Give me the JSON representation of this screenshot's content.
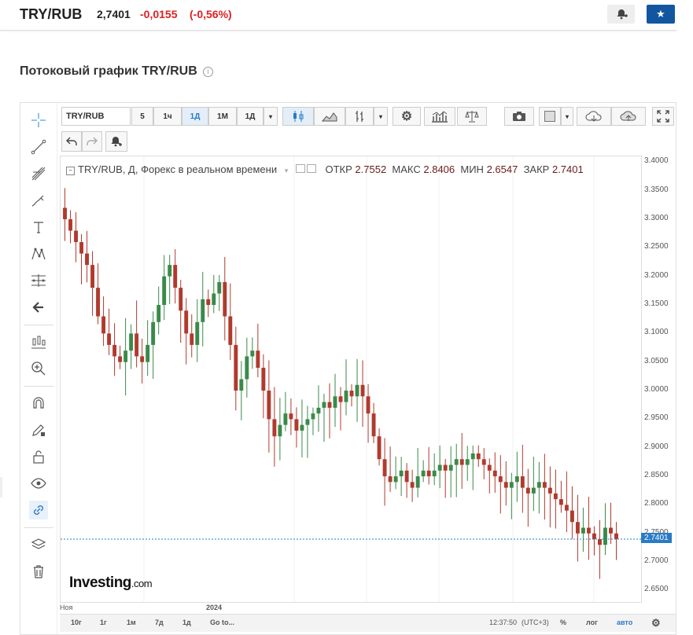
{
  "header": {
    "pair": "TRY/RUB",
    "price": "2,7401",
    "change": "-0,0155",
    "change_pct": "(-0,56%)"
  },
  "section_title": "Потоковый график TRY/RUB",
  "toolbar": {
    "symbol": "TRY/RUB",
    "intervals": [
      "5",
      "1ч",
      "1Д",
      "1М",
      "1Д"
    ],
    "active_interval": "1Д"
  },
  "legend": {
    "name": "TRY/RUB, Д, Форекс в реальном времени",
    "open_label": "ОТКР",
    "open": "2.7552",
    "high_label": "МАКС",
    "high": "2.8406",
    "low_label": "МИН",
    "low": "2.6547",
    "close_label": "ЗАКР",
    "close": "2.7401"
  },
  "yaxis_ticks": [
    "3.4000",
    "3.3500",
    "3.3000",
    "3.2500",
    "3.2000",
    "3.1500",
    "3.1000",
    "3.0500",
    "3.0000",
    "2.9500",
    "2.9000",
    "2.8500",
    "2.8000",
    "2.7500",
    "2.7000",
    "2.6500"
  ],
  "current_price_label": "2.7401",
  "xaxis_labels": [
    "Ноя",
    "2024"
  ],
  "bottom": {
    "ranges": [
      "10г",
      "1г",
      "1м",
      "7д",
      "1д",
      "Go to..."
    ],
    "time": "12:37:50",
    "tz": "(UTC+3)",
    "pct": "%",
    "log": "лог",
    "auto": "авто"
  },
  "logo": {
    "main": "Investing",
    "suffix": ".com"
  },
  "colors": {
    "up": "#3a8a4a",
    "down": "#b03a2e",
    "accent": "#2a7bc6",
    "star": "#1256a0"
  },
  "chart_data": {
    "type": "candlestick",
    "ylim": [
      2.63,
      3.41
    ],
    "close_series": [
      3.3,
      3.28,
      3.26,
      3.24,
      3.22,
      3.18,
      3.13,
      3.1,
      3.08,
      3.06,
      3.05,
      3.07,
      3.1,
      3.06,
      3.05,
      3.08,
      3.12,
      3.15,
      3.2,
      3.22,
      3.18,
      3.14,
      3.1,
      3.08,
      3.12,
      3.16,
      3.15,
      3.17,
      3.19,
      3.13,
      3.08,
      3.0,
      3.02,
      3.06,
      3.07,
      3.04,
      3.0,
      2.95,
      2.92,
      2.94,
      2.96,
      2.95,
      2.93,
      2.94,
      2.95,
      2.96,
      2.97,
      2.98,
      2.97,
      2.99,
      2.98,
      3.0,
      2.99,
      3.01,
      2.99,
      2.96,
      2.92,
      2.88,
      2.85,
      2.84,
      2.85,
      2.86,
      2.84,
      2.83,
      2.85,
      2.86,
      2.85,
      2.86,
      2.87,
      2.86,
      2.87,
      2.88,
      2.87,
      2.88,
      2.89,
      2.88,
      2.87,
      2.86,
      2.85,
      2.84,
      2.83,
      2.84,
      2.85,
      2.83,
      2.82,
      2.83,
      2.84,
      2.83,
      2.82,
      2.81,
      2.8,
      2.79,
      2.77,
      2.75,
      2.76,
      2.75,
      2.74,
      2.73,
      2.76,
      2.75,
      2.74
    ]
  }
}
